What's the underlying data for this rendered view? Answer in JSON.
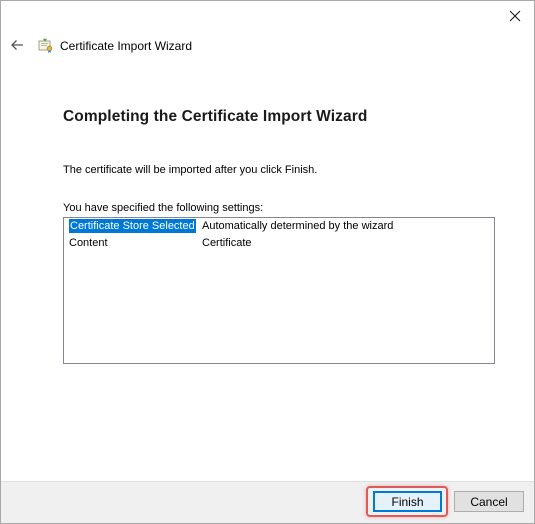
{
  "window": {
    "title": "Certificate Import Wizard"
  },
  "page": {
    "heading": "Completing the Certificate Import Wizard",
    "info_text": "The certificate will be imported after you click Finish.",
    "settings_label": "You have specified the following settings:"
  },
  "settings": [
    {
      "key": "Certificate Store Selected",
      "value": "Automatically determined by the wizard",
      "selected": true
    },
    {
      "key": "Content",
      "value": "Certificate",
      "selected": false
    }
  ],
  "buttons": {
    "finish": "Finish",
    "cancel": "Cancel"
  },
  "icons": {
    "close": "close-icon",
    "back": "back-arrow-icon",
    "wizard": "certificate-icon"
  },
  "colors": {
    "selection": "#0078d7",
    "highlight": "#e05a5a",
    "footer_bg": "#f0f0f0"
  }
}
